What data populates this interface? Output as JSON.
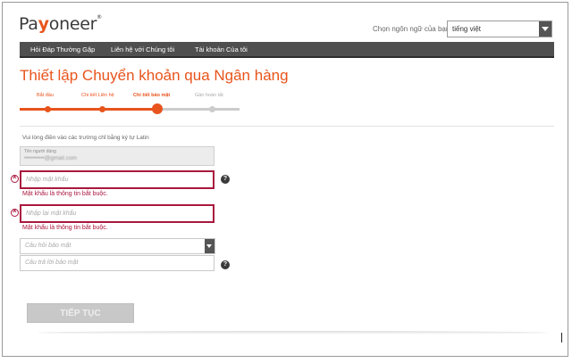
{
  "header": {
    "logo_pre": "Pa",
    "logo_y": "y",
    "logo_post": "oneer",
    "logo_reg": "®",
    "language_label": "Chọn ngôn ngữ của bạn",
    "language_value": "tiếng việt"
  },
  "nav": {
    "items": [
      {
        "label": "Hỏi Đáp Thường Gặp"
      },
      {
        "label": "Liên hệ với Chúng tôi"
      },
      {
        "label": "Tài khoản Của tôi"
      }
    ]
  },
  "page": {
    "title": "Thiết lập Chuyển khoản qua Ngân hàng",
    "instruction": "Vui lòng điền vào các trường chỉ bằng ký tự Latin"
  },
  "steps": {
    "items": [
      {
        "label": "Bắt đầu",
        "state": "done"
      },
      {
        "label": "Chi tiết Liên hệ",
        "state": "done"
      },
      {
        "label": "Chi tiết bảo mật",
        "state": "current"
      },
      {
        "label": "Gần hoàn tất",
        "state": "todo"
      }
    ]
  },
  "form": {
    "username_label": "Tên người dùng",
    "username_value": "••••••••••@gmail.com",
    "password_placeholder": "Nhập mật khẩu",
    "password_error": "Mật khẩu là thông tin bắt buộc.",
    "confirm_placeholder": "Nhập lại mật khẩu",
    "confirm_error": "Mật khẩu là thông tin bắt buộc.",
    "security_question_placeholder": "Câu hỏi bảo mật",
    "security_answer_placeholder": "Câu trả lời bảo mật",
    "help_glyph": "?",
    "continue_label": "TIẾP TỤC"
  },
  "colors": {
    "accent": "#e8541d",
    "error": "#a9183e",
    "nav_bg": "#4f4f4f"
  }
}
